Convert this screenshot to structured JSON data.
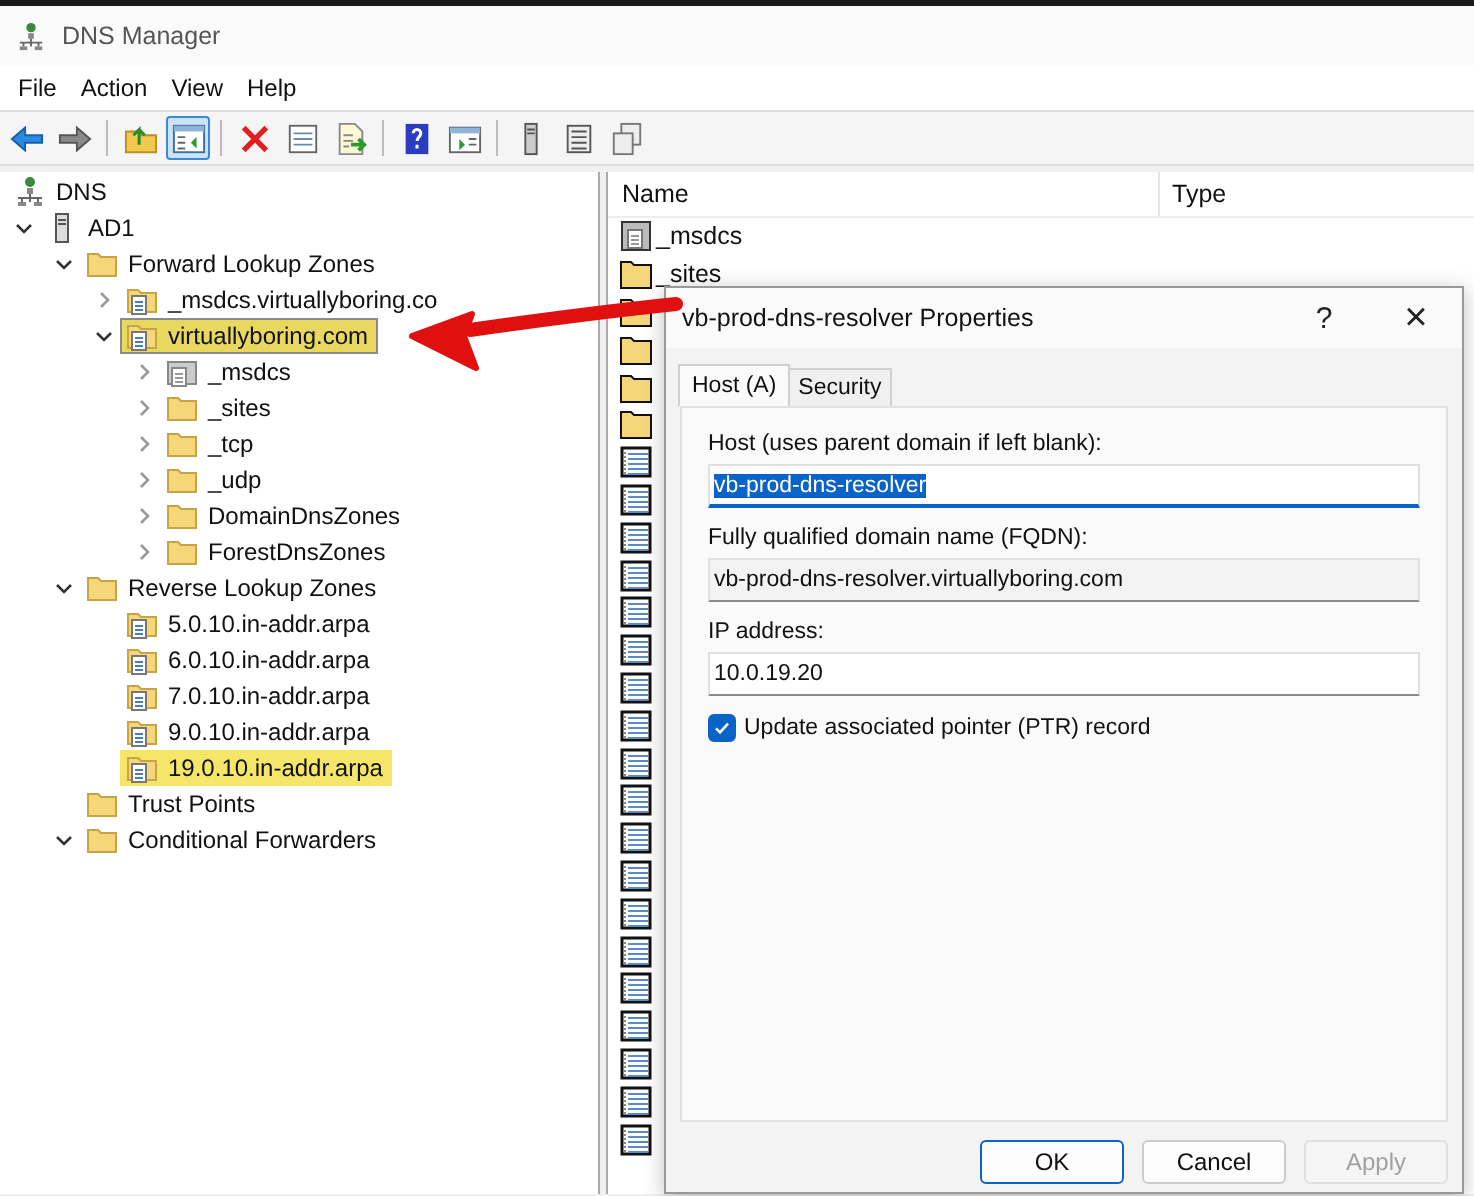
{
  "window": {
    "title": "DNS Manager"
  },
  "menu": [
    "File",
    "Action",
    "View",
    "Help"
  ],
  "toolbar": [
    [
      {
        "pressed": false
      },
      {
        "pressed": false
      }
    ],
    [
      {
        "pressed": false
      },
      {
        "pressed": true
      }
    ],
    [
      {
        "pressed": false
      },
      {
        "pressed": false
      },
      {
        "pressed": false
      }
    ],
    [
      {
        "pressed": false
      },
      {
        "pressed": false
      }
    ],
    [
      {
        "pressed": false
      },
      {
        "pressed": false
      },
      {
        "pressed": false
      }
    ]
  ],
  "tree": [
    {
      "label": "DNS",
      "kind": "dns",
      "children": [
        {
          "label": "AD1",
          "kind": "server",
          "expanded": true,
          "children": [
            {
              "label": "Forward Lookup Zones",
              "kind": "folder",
              "expanded": true,
              "children": [
                {
                  "label": "_msdcs.virtuallyboring.co",
                  "kind": "zone",
                  "expanded": false
                },
                {
                  "label": "virtuallyboring.com",
                  "kind": "zone",
                  "expanded": true,
                  "selected": true,
                  "highlighted": true,
                  "children": [
                    {
                      "label": "_msdcs",
                      "kind": "zone-gray",
                      "expanded": false
                    },
                    {
                      "label": "_sites",
                      "kind": "folder",
                      "expanded": false
                    },
                    {
                      "label": "_tcp",
                      "kind": "folder",
                      "expanded": false
                    },
                    {
                      "label": "_udp",
                      "kind": "folder",
                      "expanded": false
                    },
                    {
                      "label": "DomainDnsZones",
                      "kind": "folder",
                      "expanded": false
                    },
                    {
                      "label": "ForestDnsZones",
                      "kind": "folder",
                      "expanded": false
                    }
                  ]
                }
              ]
            },
            {
              "label": "Reverse Lookup Zones",
              "kind": "folder",
              "expanded": true,
              "children": [
                {
                  "label": "5.0.10.in-addr.arpa",
                  "kind": "zone",
                  "highlighted": false
                },
                {
                  "label": "6.0.10.in-addr.arpa",
                  "kind": "zone",
                  "highlighted": false
                },
                {
                  "label": "7.0.10.in-addr.arpa",
                  "kind": "zone",
                  "highlighted": false
                },
                {
                  "label": "9.0.10.in-addr.arpa",
                  "kind": "zone",
                  "highlighted": false
                },
                {
                  "label": "19.0.10.in-addr.arpa",
                  "kind": "zone",
                  "highlighted": true
                }
              ]
            },
            {
              "label": "Trust Points",
              "kind": "folder"
            },
            {
              "label": "Conditional Forwarders",
              "kind": "folder",
              "expanded": true
            }
          ]
        }
      ]
    }
  ],
  "list": {
    "columns": [
      "Name",
      "Type"
    ],
    "rows": [
      {
        "kind": "zone-gray",
        "name": "_msdcs"
      },
      {
        "kind": "folder",
        "name": "_sites"
      },
      {
        "kind": "folder"
      },
      {
        "kind": "folder"
      },
      {
        "kind": "folder"
      },
      {
        "kind": "folder"
      },
      {
        "kind": "record"
      },
      {
        "kind": "record"
      },
      {
        "kind": "record"
      },
      {
        "kind": "record"
      },
      {
        "kind": "record"
      },
      {
        "kind": "record"
      },
      {
        "kind": "record"
      },
      {
        "kind": "record"
      },
      {
        "kind": "record"
      },
      {
        "kind": "record"
      },
      {
        "kind": "record"
      },
      {
        "kind": "record"
      },
      {
        "kind": "record"
      },
      {
        "kind": "record"
      },
      {
        "kind": "record"
      },
      {
        "kind": "record"
      },
      {
        "kind": "record"
      },
      {
        "kind": "record"
      },
      {
        "kind": "record"
      }
    ]
  },
  "dialog": {
    "title": "vb-prod-dns-resolver Properties",
    "help": "?",
    "close": "×",
    "tabs": [
      {
        "label": "Host (A)",
        "selected": true
      },
      {
        "label": "Security",
        "selected": false
      }
    ],
    "fields": [
      {
        "label": "Host (uses parent domain if left blank):",
        "value": "vb-prod-dns-resolver",
        "kind": "edit",
        "focused": true,
        "text_selected": true
      },
      {
        "label": "Fully qualified domain name (FQDN):",
        "value": "vb-prod-dns-resolver.virtuallyboring.com",
        "kind": "readonly",
        "focused": false,
        "text_selected": false
      },
      {
        "label": "IP address:",
        "value": "10.0.19.20",
        "kind": "edit",
        "focused": false,
        "text_selected": false
      }
    ],
    "checkbox": {
      "label": "Update associated pointer (PTR) record",
      "checked": true
    },
    "buttons": [
      {
        "label": "OK",
        "default": true,
        "disabled": false
      },
      {
        "label": "Cancel",
        "default": false,
        "disabled": false
      },
      {
        "label": "Apply",
        "default": false,
        "disabled": true
      }
    ]
  }
}
